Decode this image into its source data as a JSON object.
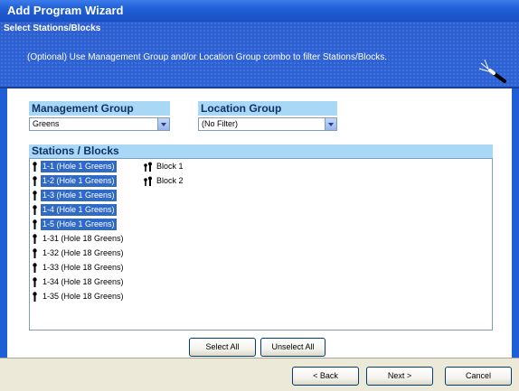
{
  "window": {
    "title": "Add Program Wizard"
  },
  "header": {
    "section_title": "Select Stations/Blocks",
    "description": "(Optional) Use Management Group and/or Location Group combo to filter Stations/Blocks.",
    "icon": "magic-wand-icon"
  },
  "management_group": {
    "label": "Management Group",
    "value": "Greens"
  },
  "location_group": {
    "label": "Location Group",
    "value": "(No Filter)"
  },
  "stations": {
    "label": "Stations / Blocks",
    "items": [
      {
        "text": "1-1  (Hole 1 Greens)",
        "selected": true
      },
      {
        "text": "1-2  (Hole 1 Greens)",
        "selected": true
      },
      {
        "text": "1-3  (Hole 1 Greens)",
        "selected": true
      },
      {
        "text": "1-4  (Hole 1 Greens)",
        "selected": true
      },
      {
        "text": "1-5  (Hole 1 Greens)",
        "selected": true
      },
      {
        "text": "1-31  (Hole 18 Greens)",
        "selected": false
      },
      {
        "text": "1-32  (Hole 18 Greens)",
        "selected": false
      },
      {
        "text": "1-33  (Hole 18 Greens)",
        "selected": false
      },
      {
        "text": "1-34  (Hole 18 Greens)",
        "selected": false
      },
      {
        "text": "1-35  (Hole 18 Greens)",
        "selected": false
      }
    ],
    "blocks": [
      "Block 1",
      "Block 2"
    ]
  },
  "buttons": {
    "select_all": "Select All",
    "unselect_all": "Unselect All",
    "back": "< Back",
    "next": "Next >",
    "cancel": "Cancel"
  },
  "colors": {
    "title_bar": "#1f5fd6",
    "header_bg": "#2b5ed1",
    "label_bg": "#a8d8f5",
    "selection": "#316ac5"
  }
}
